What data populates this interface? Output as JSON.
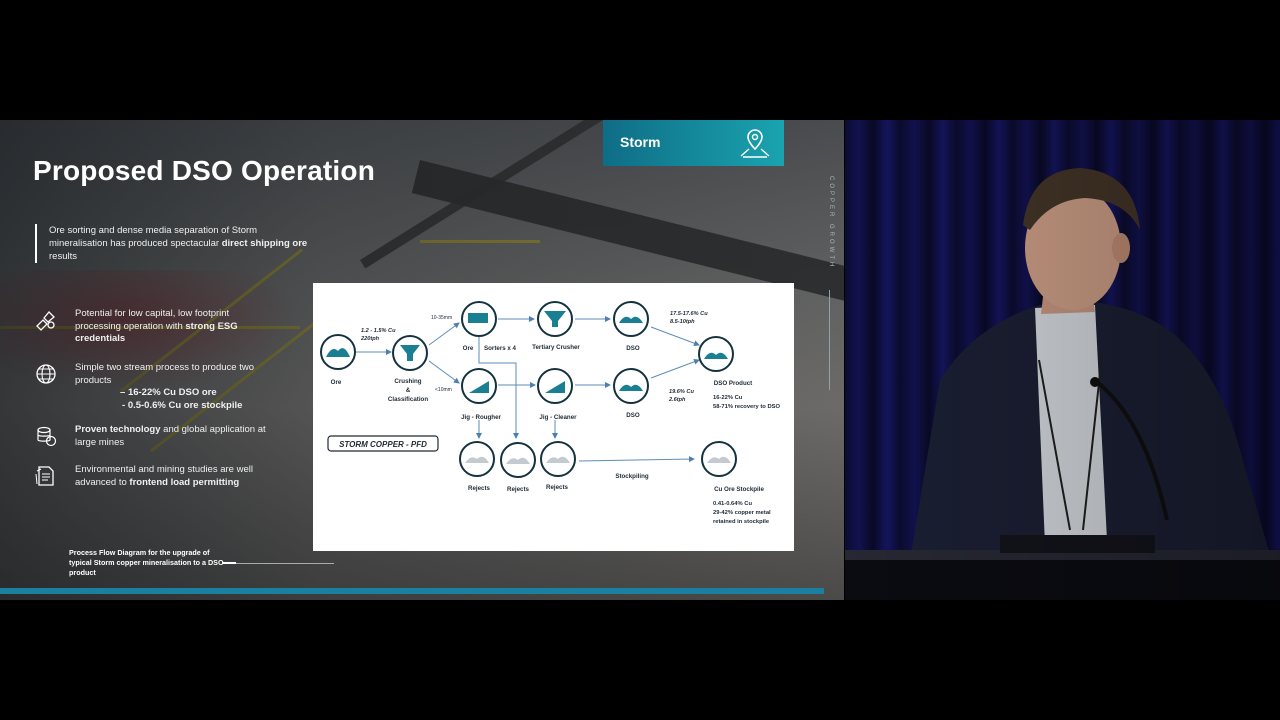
{
  "slide": {
    "title": "Proposed DSO Operation",
    "brand": "Storm",
    "vertical_tag": "COPPER GROWTH",
    "intro_plain": "Ore sorting and dense media separation of Storm mineralisation has produced spectacular ",
    "intro_bold": "direct shipping ore",
    "intro_tail": " results",
    "bullets": [
      {
        "icon": "tools-icon",
        "text_plain": "Potential for low capital, low footprint processing operation with ",
        "text_bold": "strong ESG credentials",
        "text_tail": ""
      },
      {
        "icon": "globe-icon",
        "text_plain": "Simple two stream process to produce two products",
        "text_bold": "",
        "text_tail": "",
        "sub": [
          "16-22% Cu DSO ore",
          "0.5-0.6% Cu ore stockpile"
        ]
      },
      {
        "icon": "coins-icon",
        "text_plain": "",
        "text_bold": "Proven technology",
        "text_tail": " and global application at large mines"
      },
      {
        "icon": "document-icon",
        "text_plain": "Environmental and mining studies are well advanced to ",
        "text_bold": "frontend load permitting",
        "text_tail": ""
      }
    ],
    "caption": "Process Flow Diagram for the upgrade of typical Storm copper mineralisation to a DSO product"
  },
  "pfd": {
    "badge": "STORM COPPER - PFD",
    "nodes": {
      "ore": "Ore",
      "crushing": "Crushing & Classification",
      "ore_top": "Ore",
      "sorters": "Sorters x 4",
      "tertiary": "Tertiary Crusher",
      "dso_top": "DSO",
      "jig_rougher": "Jig - Rougher",
      "jig_cleaner": "Jig - Cleaner",
      "dso_mid": "DSO",
      "dso_product": "DSO Product",
      "rejects_1": "Rejects",
      "rejects_2": "Rejects",
      "rejects_3": "Rejects",
      "stockpiling": "Stockpiling",
      "cu_stockpile": "Cu Ore Stockpile"
    },
    "annotations": {
      "feed": [
        "1.2 - 1.5% Cu",
        "220tph"
      ],
      "size_coarse": "10-35mm",
      "size_fine": "<10mm",
      "dso_top_grade": [
        "17.5-17.6% Cu",
        "8.5-10tph"
      ],
      "dso_mid_grade": [
        "19.6% Cu",
        "2.6tph"
      ],
      "dso_product_grade": [
        "16-22% Cu",
        "58-71% recovery to DSO"
      ],
      "stockpile_grade": [
        "0.41-0.64% Cu",
        "29-42% copper metal",
        "retained in stockpile"
      ]
    }
  }
}
